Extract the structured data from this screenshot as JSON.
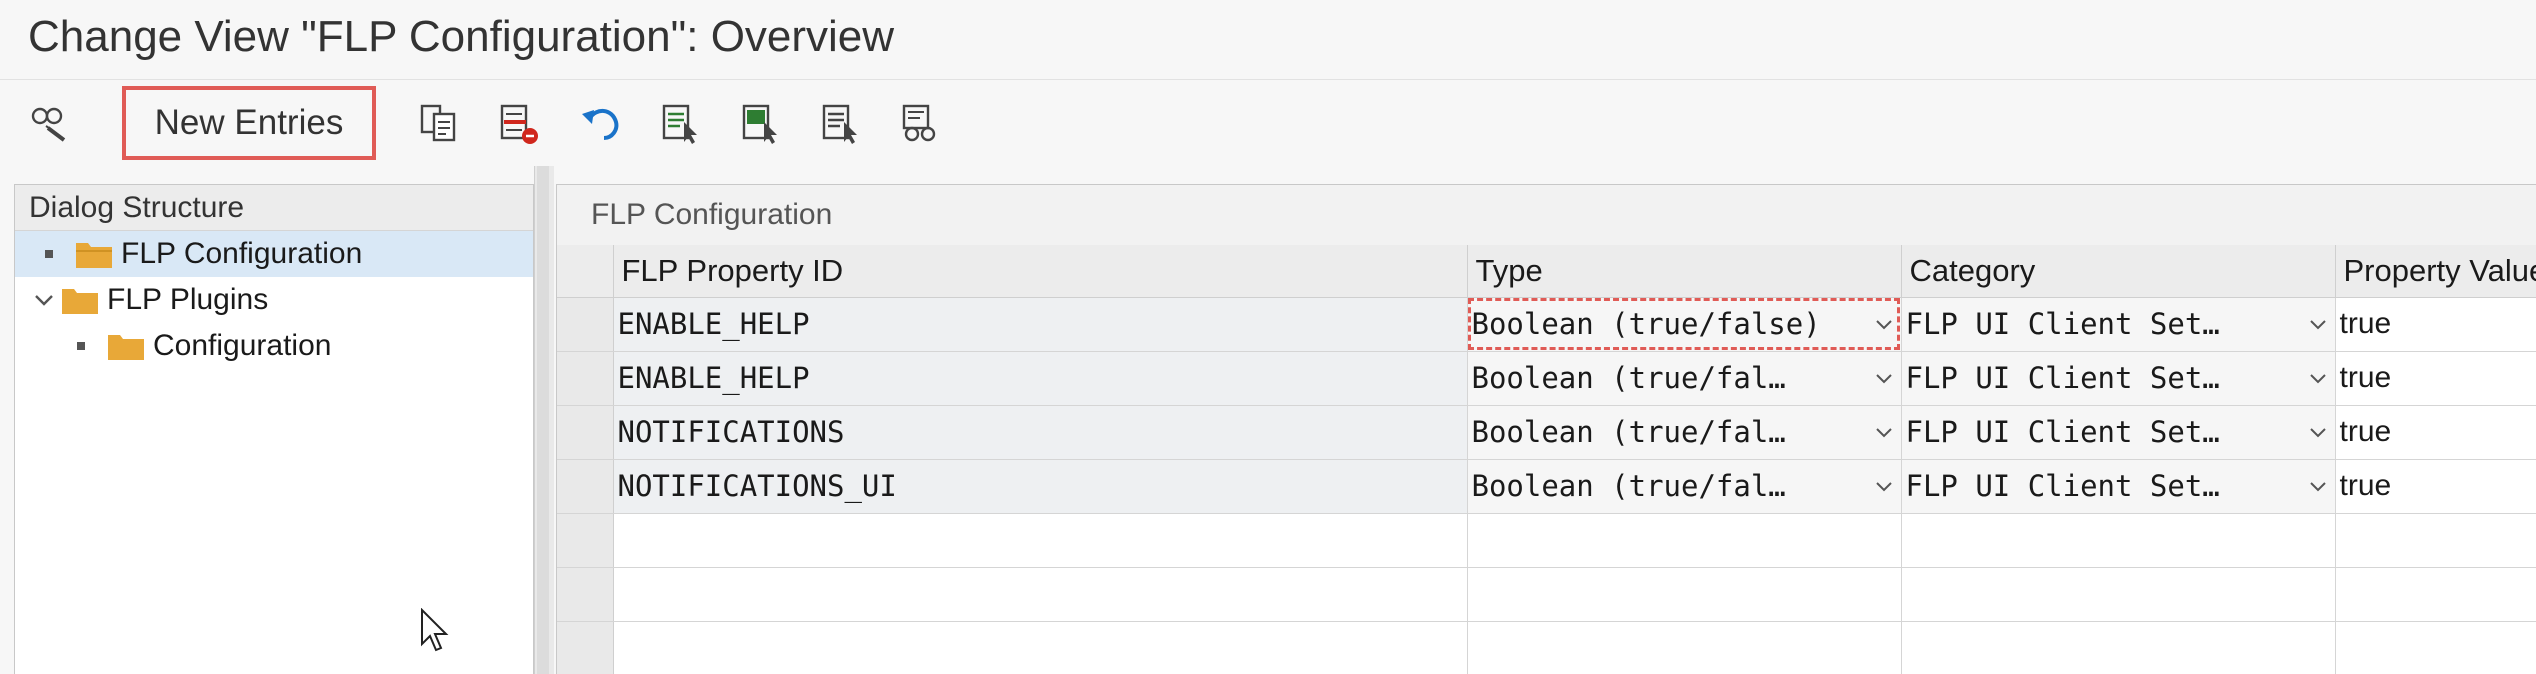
{
  "window": {
    "title": "Change View \"FLP Configuration\": Overview"
  },
  "toolbar": {
    "new_entries_label": "New Entries",
    "icons": [
      "display-change-icon",
      "copy-as-icon",
      "delete-icon",
      "undo-icon",
      "select-all-icon",
      "select-block-icon",
      "deselect-all-icon",
      "find-icon"
    ]
  },
  "dialog_structure": {
    "header": "Dialog Structure",
    "items": [
      {
        "label": "FLP Configuration",
        "selected": true,
        "level": 0,
        "expander": "bullet"
      },
      {
        "label": "FLP Plugins",
        "selected": false,
        "level": 0,
        "expander": "chevron-down"
      },
      {
        "label": "Configuration",
        "selected": false,
        "level": 1,
        "expander": "bullet"
      }
    ]
  },
  "table": {
    "caption": "FLP Configuration",
    "columns": [
      "FLP Property ID",
      "Type",
      "Category",
      "Property Value"
    ],
    "rows": [
      {
        "id": "ENABLE_HELP",
        "type": "Boolean (true/false)",
        "category": "FLP UI Client Set…",
        "value": "true"
      },
      {
        "id": "ENABLE_HELP",
        "type": "Boolean (true/fal…",
        "category": "FLP UI Client Set…",
        "value": "true"
      },
      {
        "id": "NOTIFICATIONS",
        "type": "Boolean (true/fal…",
        "category": "FLP UI Client Set…",
        "value": "true"
      },
      {
        "id": "NOTIFICATIONS_UI",
        "type": "Boolean (true/fal…",
        "category": "FLP UI Client Set…",
        "value": "true"
      }
    ]
  },
  "colors": {
    "highlight_border": "#e05b56",
    "folder": "#e8a838",
    "selected_row": "#d9e8f6"
  }
}
